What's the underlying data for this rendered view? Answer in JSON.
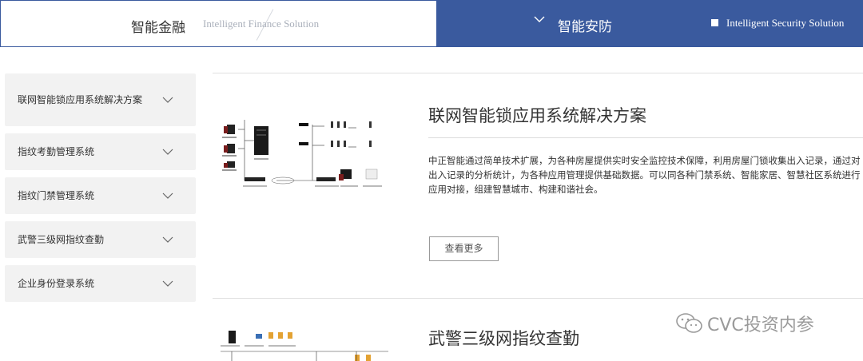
{
  "tabs": {
    "left": {
      "label": "智能金融",
      "subtitle": "Intelligent Finance Solution"
    },
    "right": {
      "label": "智能安防",
      "subtitle": "Intelligent Security Solution"
    }
  },
  "sidebar": {
    "items": [
      {
        "label": "联网智能锁应用系统解决方案",
        "icon": "chevron-down-icon"
      },
      {
        "label": "指纹考勤管理系统",
        "icon": "chevron-down-icon"
      },
      {
        "label": "指纹门禁管理系统",
        "icon": "chevron-down-icon"
      },
      {
        "label": "武警三级网指纹查勤",
        "icon": "chevron-down-icon"
      },
      {
        "label": "企业身份登录系统",
        "icon": "chevron-down-icon"
      }
    ]
  },
  "solutions": [
    {
      "title": "联网智能锁应用系统解决方案",
      "description": "中正智能通过简单技术扩展，为各种房屋提供实时安全监控技术保障，利用房屋门锁收集出入记录，通过对出入记录的分析统计，为各种应用管理提供基础数据。可以同各种门禁系统、智能家居、智慧社区系统进行应用对接，组建智慧城市、构建和谐社会。",
      "more_label": "查看更多"
    },
    {
      "title": "武警三级网指纹查勤"
    }
  ],
  "watermark": {
    "text": "CVC投资内参",
    "icon": "wechat-icon"
  },
  "colors": {
    "accent": "#3a5a9e",
    "sidebar_bg": "#f2f2f2",
    "divider": "#e0e0e0"
  }
}
